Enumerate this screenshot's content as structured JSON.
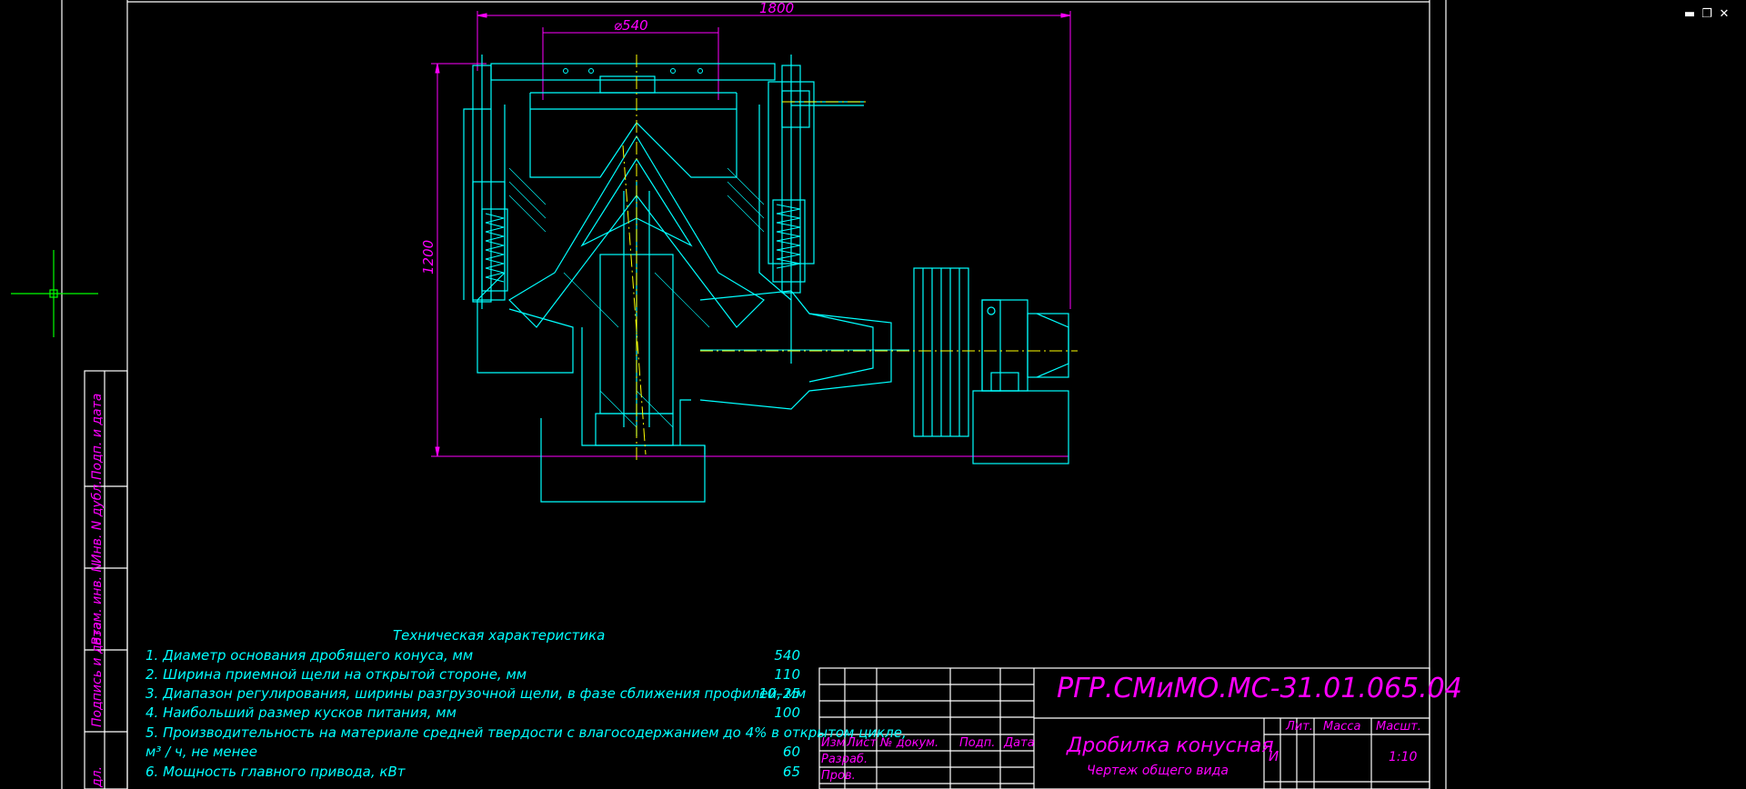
{
  "window": {
    "minimize_glyph": "▬",
    "restore_glyph": "❐",
    "close_glyph": "✕"
  },
  "colors": {
    "cyan": "#00ffff",
    "magenta": "#ff00ff",
    "yellow": "#ffff00",
    "white": "#ffffff",
    "green": "#00ff00",
    "bg": "#000000"
  },
  "dimensions": {
    "overall_width": "1800",
    "diameter": "⌀540",
    "height": "1200"
  },
  "spec": {
    "title": "Техническая характеристика",
    "rows": [
      {
        "text": "1. Диаметр основания дробящего конуса, мм",
        "value": "540"
      },
      {
        "text": "2. Ширина приемной щели на открытой стороне, мм",
        "value": "110"
      },
      {
        "text": "3. Диапазон регулирования, ширины разгрузочной щели, в фазе сближения профилей, мм",
        "value": "10–25"
      },
      {
        "text": "4.  Наибольший размер кусков питания, мм",
        "value": "100"
      },
      {
        "text": "5. Производительность на материале средней твердости с влагосодержанием до 4% в открытом цикле,",
        "value": ""
      },
      {
        "text": "м³ / ч, не менее",
        "value": "60"
      },
      {
        "text": "6. Мощность главного привода, кВт",
        "value": "65"
      }
    ]
  },
  "side_labels": [
    "Подп. и дата",
    "Инв. N дубл.",
    "Взам. инв. N",
    "Подпись и дата",
    "дл."
  ],
  "title_block": {
    "designation": "РГР.СМиМО.МС-31.01.065.04",
    "name": "Дробилка конусная",
    "subtitle": "Чертеж общего вида",
    "col_izm": "Изм",
    "col_list": "Лист",
    "col_doc": "№ докум.",
    "col_podp": "Подп.",
    "col_date": "Дата",
    "row_razrab": "Разраб.",
    "row_prov": "Пров.",
    "lit_header": "Лит.",
    "mass_header": "Масса",
    "scale_header": "Масшт.",
    "lit_value": "И",
    "scale_value": "1:10"
  }
}
